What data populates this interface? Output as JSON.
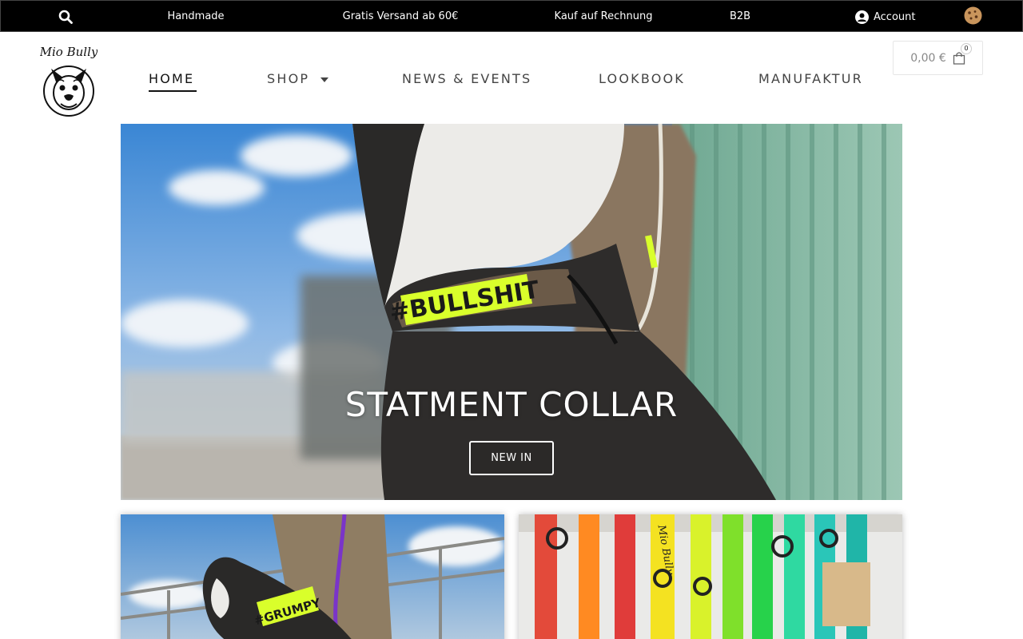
{
  "topbar": {
    "search_icon": "search-icon",
    "items": [
      "Handmade",
      "Gratis Versand ab 60€",
      "Kauf auf Rechnung",
      "B2B"
    ],
    "account_label": "Account",
    "account_icon": "user-circle-icon",
    "cookie_icon": "cookie-icon"
  },
  "header": {
    "logo_text": "Mio Bully",
    "nav": [
      {
        "label": "HOME",
        "active": true
      },
      {
        "label": "SHOP",
        "has_dropdown": true
      },
      {
        "label": "NEWS & EVENTS"
      },
      {
        "label": "LOOKBOOK"
      },
      {
        "label": "MANUFAKTUR"
      }
    ],
    "cart": {
      "amount": "0,00 €",
      "count": "0",
      "icon": "shopping-bag-icon"
    }
  },
  "hero": {
    "title": "STATMENT COLLAR",
    "button_label": "NEW IN",
    "collar_text": "#BULLSHIT"
  },
  "tiles": [
    {
      "collar_text": "#GRUMPY"
    },
    {
      "brand_text": "Mio Bully"
    }
  ],
  "colors": {
    "topbar_bg": "#000000",
    "neon_yellow": "#d9ff2b",
    "sky_blue": "#3d8fd8",
    "wall_green": "#7fb7a0"
  }
}
